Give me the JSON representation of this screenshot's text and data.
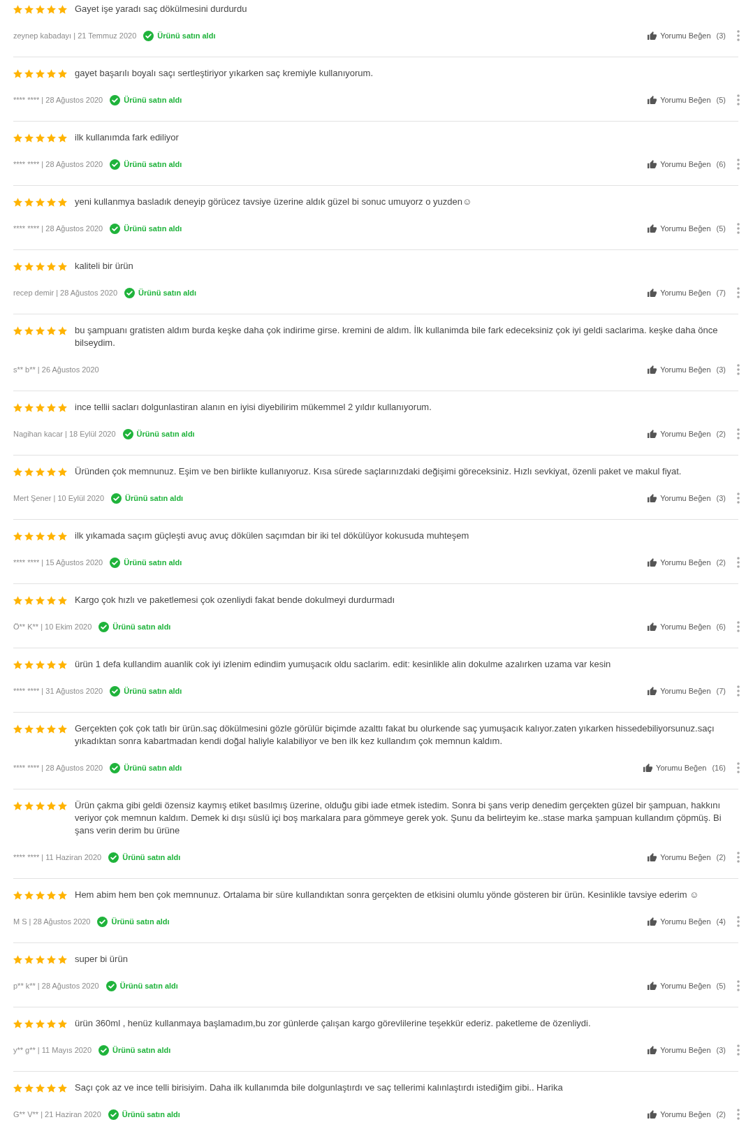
{
  "reviews": [
    {
      "stars": 5,
      "text": "Gayet işe yaradı saç dökülmesini durdurdu",
      "byline": "zeynep kabadayı | 21 Temmuz 2020",
      "verified": true,
      "verified_label": "Ürünü satın aldı",
      "like_label": "Yorumu Beğen",
      "like_count": "(3)"
    },
    {
      "stars": 5,
      "text": "gayet başarılı boyalı saçı sertleştiriyor yıkarken saç kremiyle kullanıyorum.",
      "byline": "**** **** | 28 Ağustos 2020",
      "verified": true,
      "verified_label": "Ürünü satın aldı",
      "like_label": "Yorumu Beğen",
      "like_count": "(5)"
    },
    {
      "stars": 5,
      "text": "ilk kullanımda fark ediliyor",
      "byline": "**** **** | 28 Ağustos 2020",
      "verified": true,
      "verified_label": "Ürünü satın aldı",
      "like_label": "Yorumu Beğen",
      "like_count": "(6)"
    },
    {
      "stars": 5,
      "text": "yeni kullanmya basladık deneyip görücez tavsiye üzerine aldık güzel bi sonuc umuyorz o yuzden☺",
      "byline": "**** **** | 28 Ağustos 2020",
      "verified": true,
      "verified_label": "Ürünü satın aldı",
      "like_label": "Yorumu Beğen",
      "like_count": "(5)"
    },
    {
      "stars": 5,
      "text": "kaliteli bir ürün",
      "byline": "recep demir | 28 Ağustos 2020",
      "verified": true,
      "verified_label": "Ürünü satın aldı",
      "like_label": "Yorumu Beğen",
      "like_count": "(7)"
    },
    {
      "stars": 5,
      "text": "bu şampuanı gratisten aldım burda keşke daha çok indirime girse. kremini de aldım. İlk kullanimda bile fark edeceksiniz çok iyi geldi saclarima. keşke daha önce bilseydim.",
      "byline": "s** b** | 26 Ağustos 2020",
      "verified": false,
      "like_label": "Yorumu Beğen",
      "like_count": "(3)"
    },
    {
      "stars": 5,
      "text": "ince tellii sacları dolgunlastiran alanın en iyisi diyebilirim mükemmel 2 yıldır kullanıyorum.",
      "byline": "Nagihan kacar | 18 Eylül 2020",
      "verified": true,
      "verified_label": "Ürünü satın aldı",
      "like_label": "Yorumu Beğen",
      "like_count": "(2)"
    },
    {
      "stars": 5,
      "text": "Üründen çok memnunuz. Eşim ve ben birlikte kullanıyoruz. Kısa sürede saçlarınızdaki değişimi göreceksiniz. Hızlı sevkiyat, özenli paket ve makul fiyat.",
      "byline": "Mert Şener | 10 Eylül 2020",
      "verified": true,
      "verified_label": "Ürünü satın aldı",
      "like_label": "Yorumu Beğen",
      "like_count": "(3)"
    },
    {
      "stars": 5,
      "text": "ilk yıkamada saçım güçleşti avuç avuç dökülen saçımdan bir iki tel dökülüyor kokusuda muhteşem",
      "byline": "**** **** | 15 Ağustos 2020",
      "verified": true,
      "verified_label": "Ürünü satın aldı",
      "like_label": "Yorumu Beğen",
      "like_count": "(2)"
    },
    {
      "stars": 5,
      "text": "Kargo çok hızlı ve paketlemesi çok ozenliydi fakat bende dokulmeyi durdurmadı",
      "byline": "Ö** K** | 10 Ekim 2020",
      "verified": true,
      "verified_label": "Ürünü satın aldı",
      "like_label": "Yorumu Beğen",
      "like_count": "(6)"
    },
    {
      "stars": 5,
      "text": "ürün 1 defa kullandim auanlik cok iyi izlenim edindim yumuşacık oldu saclarim. edit: kesinlikle alin dokulme azalırken uzama var kesin",
      "byline": "**** **** | 31 Ağustos 2020",
      "verified": true,
      "verified_label": "Ürünü satın aldı",
      "like_label": "Yorumu Beğen",
      "like_count": "(7)"
    },
    {
      "stars": 5,
      "text": "Gerçekten çok çok tatlı bir ürün.saç dökülmesini gözle görülür biçimde azalttı fakat bu olurkende saç yumuşacık kalıyor.zaten yıkarken hissedebiliyorsunuz.saçı yıkadıktan sonra kabartmadan kendi doğal haliyle kalabiliyor ve ben ilk kez kullandım çok memnun kaldım.",
      "byline": "**** **** | 28 Ağustos 2020",
      "verified": true,
      "verified_label": "Ürünü satın aldı",
      "like_label": "Yorumu Beğen",
      "like_count": "(16)"
    },
    {
      "stars": 5,
      "text": "Ürün çakma gibi geldi özensiz kaymış etiket basılmış üzerine, olduğu gibi iade etmek istedim. Sonra bi şans verip denedim gerçekten güzel bir şampuan, hakkını veriyor çok memnun kaldım. Demek ki dışı süslü içi boş markalara para gömmeye gerek yok. Şunu da belirteyim ke..stase marka şampuan kullandım çöpmüş. Bi şans verin derim bu ürüne",
      "byline": "**** **** | 11 Haziran 2020",
      "verified": true,
      "verified_label": "Ürünü satın aldı",
      "like_label": "Yorumu Beğen",
      "like_count": "(2)"
    },
    {
      "stars": 5,
      "text": "Hem abim hem ben çok memnunuz. Ortalama bir süre kullandıktan sonra gerçekten de etkisini olumlu yönde gösteren bir ürün. Kesinlikle tavsiye ederim ☺",
      "byline": "M S | 28 Ağustos 2020",
      "verified": true,
      "verified_label": "Ürünü satın aldı",
      "like_label": "Yorumu Beğen",
      "like_count": "(4)"
    },
    {
      "stars": 5,
      "text": "super bi ürün",
      "byline": "p** k** | 28 Ağustos 2020",
      "verified": true,
      "verified_label": "Ürünü satın aldı",
      "like_label": "Yorumu Beğen",
      "like_count": "(5)"
    },
    {
      "stars": 5,
      "text": "ürün 360ml , henüz kullanmaya başlamadım,bu zor günlerde çalışan kargo görevlilerine teşekkür ederiz. paketleme de özenliydi.",
      "byline": "y** g** | 11 Mayıs 2020",
      "verified": true,
      "verified_label": "Ürünü satın aldı",
      "like_label": "Yorumu Beğen",
      "like_count": "(3)"
    },
    {
      "stars": 5,
      "text": "Saçı çok az ve ince telli birisiyim. Daha ilk kullanımda bile dolgunlaştırdı ve saç tellerimi kalınlaştırdı istediğim gibi.. Harika",
      "byline": "G** V** | 21 Haziran 2020",
      "verified": true,
      "verified_label": "Ürünü satın aldı",
      "like_label": "Yorumu Beğen",
      "like_count": "(2)"
    }
  ]
}
